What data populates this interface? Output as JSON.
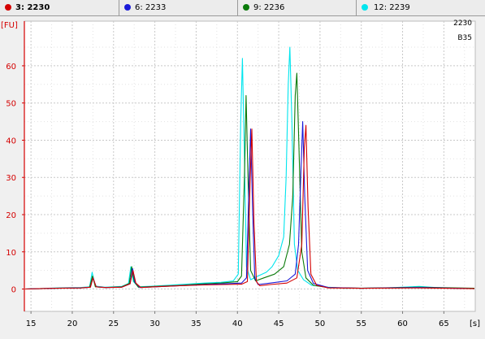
{
  "tabs": [
    {
      "label": "3: 2230",
      "color": "#d40000",
      "active": true
    },
    {
      "label": "6: 2233",
      "color": "#1a1ad8",
      "active": false
    },
    {
      "label": "9: 2236",
      "color": "#0a7a0a",
      "active": false
    },
    {
      "label": "12: 2239",
      "color": "#00e5ee",
      "active": false
    }
  ],
  "chart_data": {
    "type": "line",
    "ylabel": "[FU]",
    "xlabel": "[s]",
    "annotations": [
      "2230",
      "B35"
    ],
    "xlim": [
      14.2,
      68.8
    ],
    "ylim": [
      -6,
      72
    ],
    "xticks": [
      15,
      20,
      25,
      30,
      35,
      40,
      45,
      50,
      55,
      60,
      65
    ],
    "yticks": [
      0,
      10,
      20,
      30,
      40,
      50,
      60
    ],
    "grid": true,
    "series": [
      {
        "color": "#00e5ee",
        "points": [
          [
            14.3,
            0
          ],
          [
            16,
            0.1
          ],
          [
            18,
            0.3
          ],
          [
            21,
            0.4
          ],
          [
            22.1,
            0.6
          ],
          [
            22.4,
            4.5
          ],
          [
            22.8,
            0.8
          ],
          [
            24,
            0.5
          ],
          [
            26,
            0.7
          ],
          [
            26.8,
            1.5
          ],
          [
            27.1,
            6
          ],
          [
            27.4,
            2
          ],
          [
            28,
            0.6
          ],
          [
            30,
            0.8
          ],
          [
            33,
            1.2
          ],
          [
            36,
            1.6
          ],
          [
            38,
            1.8
          ],
          [
            39.5,
            2.2
          ],
          [
            40.1,
            4
          ],
          [
            40.4,
            45
          ],
          [
            40.6,
            62
          ],
          [
            40.85,
            35
          ],
          [
            41.1,
            6
          ],
          [
            41.6,
            2.5
          ],
          [
            42.5,
            3.5
          ],
          [
            43.5,
            4.5
          ],
          [
            44.2,
            6
          ],
          [
            45,
            9
          ],
          [
            45.6,
            14
          ],
          [
            45.9,
            30
          ],
          [
            46.15,
            55
          ],
          [
            46.35,
            65
          ],
          [
            46.6,
            45
          ],
          [
            46.9,
            12
          ],
          [
            47.3,
            5
          ],
          [
            48,
            2.5
          ],
          [
            49,
            1
          ],
          [
            51,
            0.5
          ],
          [
            53,
            0.2
          ],
          [
            58,
            0.3
          ],
          [
            61,
            0.6
          ],
          [
            62,
            0.7
          ],
          [
            64,
            0.4
          ],
          [
            66,
            0.2
          ],
          [
            68.7,
            0.2
          ]
        ]
      },
      {
        "color": "#0a7a0a",
        "points": [
          [
            14.3,
            0
          ],
          [
            16,
            0.1
          ],
          [
            18,
            0.2
          ],
          [
            21,
            0.3
          ],
          [
            22.1,
            0.5
          ],
          [
            22.45,
            3.5
          ],
          [
            22.8,
            0.6
          ],
          [
            24,
            0.4
          ],
          [
            26,
            0.6
          ],
          [
            26.9,
            1.5
          ],
          [
            27.2,
            6
          ],
          [
            27.5,
            2
          ],
          [
            28,
            0.5
          ],
          [
            30,
            0.7
          ],
          [
            33,
            1
          ],
          [
            36,
            1.4
          ],
          [
            38,
            1.6
          ],
          [
            40,
            2
          ],
          [
            40.5,
            3.5
          ],
          [
            40.85,
            30
          ],
          [
            41.05,
            52
          ],
          [
            41.3,
            28
          ],
          [
            41.6,
            5
          ],
          [
            42.2,
            2.2
          ],
          [
            43.2,
            3
          ],
          [
            44.5,
            4
          ],
          [
            45.6,
            6
          ],
          [
            46.3,
            12
          ],
          [
            46.7,
            25
          ],
          [
            47,
            52
          ],
          [
            47.2,
            58
          ],
          [
            47.45,
            38
          ],
          [
            47.8,
            10
          ],
          [
            48.3,
            3
          ],
          [
            49.2,
            1
          ],
          [
            51,
            0.4
          ],
          [
            55,
            0.2
          ],
          [
            62,
            0.5
          ],
          [
            68.7,
            0.2
          ]
        ]
      },
      {
        "color": "#1a1ad8",
        "points": [
          [
            14.3,
            0
          ],
          [
            16,
            0.1
          ],
          [
            18,
            0.2
          ],
          [
            21,
            0.3
          ],
          [
            22.2,
            0.5
          ],
          [
            22.5,
            3
          ],
          [
            22.9,
            0.6
          ],
          [
            24,
            0.4
          ],
          [
            26,
            0.5
          ],
          [
            27,
            1.4
          ],
          [
            27.3,
            5.5
          ],
          [
            27.6,
            1.8
          ],
          [
            28.2,
            0.4
          ],
          [
            30,
            0.6
          ],
          [
            33,
            0.9
          ],
          [
            36,
            1.2
          ],
          [
            38.5,
            1.4
          ],
          [
            40.5,
            1.6
          ],
          [
            41.1,
            3
          ],
          [
            41.4,
            28
          ],
          [
            41.6,
            43
          ],
          [
            41.85,
            20
          ],
          [
            42.1,
            3
          ],
          [
            42.5,
            1.2
          ],
          [
            44,
            1.6
          ],
          [
            46,
            2.2
          ],
          [
            47,
            4
          ],
          [
            47.4,
            12
          ],
          [
            47.7,
            32
          ],
          [
            47.9,
            45
          ],
          [
            48.15,
            25
          ],
          [
            48.5,
            5
          ],
          [
            49.2,
            1.5
          ],
          [
            51,
            0.4
          ],
          [
            55,
            0.2
          ],
          [
            62,
            0.4
          ],
          [
            68.7,
            0.1
          ]
        ]
      },
      {
        "color": "#d40000",
        "points": [
          [
            14.3,
            0
          ],
          [
            16,
            0.1
          ],
          [
            18,
            0.2
          ],
          [
            21,
            0.3
          ],
          [
            22.2,
            0.5
          ],
          [
            22.5,
            3
          ],
          [
            22.9,
            0.6
          ],
          [
            24,
            0.4
          ],
          [
            26,
            0.5
          ],
          [
            27,
            1.4
          ],
          [
            27.35,
            5
          ],
          [
            27.7,
            1.6
          ],
          [
            28.3,
            0.4
          ],
          [
            30,
            0.6
          ],
          [
            33,
            0.9
          ],
          [
            36,
            1.1
          ],
          [
            38.5,
            1.2
          ],
          [
            40.5,
            1.3
          ],
          [
            41.2,
            2
          ],
          [
            41.55,
            30
          ],
          [
            41.75,
            43
          ],
          [
            42,
            18
          ],
          [
            42.3,
            2
          ],
          [
            42.7,
            0.9
          ],
          [
            44,
            1.2
          ],
          [
            46,
            1.6
          ],
          [
            47.2,
            3
          ],
          [
            47.8,
            12
          ],
          [
            48.1,
            38
          ],
          [
            48.3,
            44
          ],
          [
            48.55,
            22
          ],
          [
            48.9,
            4
          ],
          [
            49.6,
            1
          ],
          [
            51,
            0.3
          ],
          [
            55,
            0.2
          ],
          [
            62,
            0.3
          ],
          [
            68.7,
            0.1
          ]
        ]
      }
    ]
  }
}
